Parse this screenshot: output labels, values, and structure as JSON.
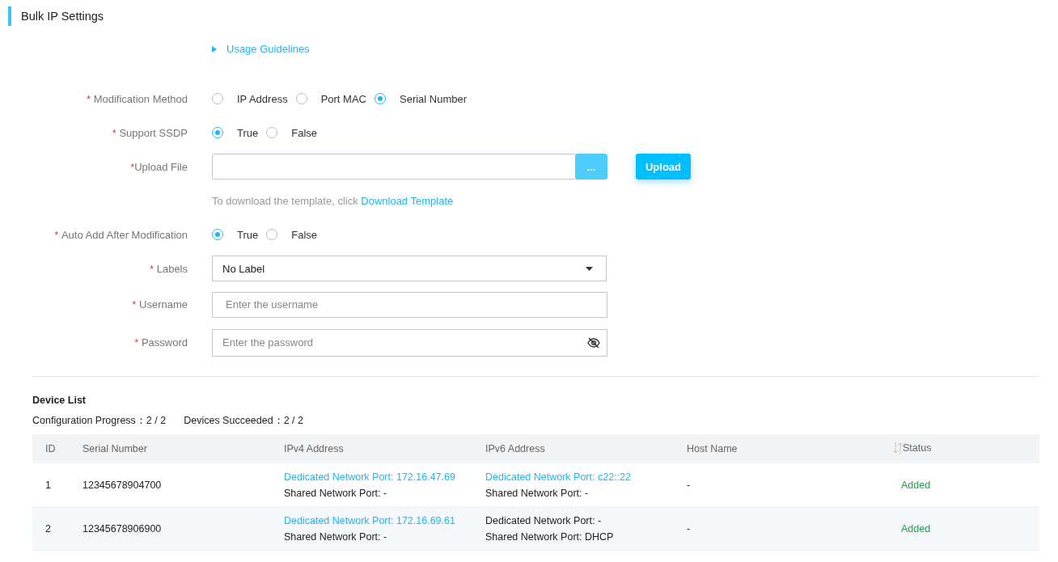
{
  "title": "Bulk IP Settings",
  "guidelines": {
    "label": "Usage Guidelines",
    "expanded": false
  },
  "form": {
    "method": {
      "mark": "*",
      "label": "Modification Method",
      "options": [
        {
          "label": "IP Address",
          "selected": false
        },
        {
          "label": "Port MAC",
          "selected": false
        },
        {
          "label": "Serial Number",
          "selected": true
        }
      ]
    },
    "ssdp": {
      "mark": "*",
      "label": "Support SSDP",
      "options": [
        {
          "label": "True",
          "selected": true
        },
        {
          "label": "False",
          "selected": false
        }
      ]
    },
    "upload": {
      "mark": "*",
      "label": "Upload File",
      "browse": "...",
      "button": "Upload"
    },
    "template_hint": {
      "text": "To download the template, click",
      "link": "Download Template"
    },
    "auto_add": {
      "mark": "*",
      "label": "Auto Add After Modification",
      "options": [
        {
          "label": "True",
          "selected": true
        },
        {
          "label": "False",
          "selected": false
        }
      ]
    },
    "labels": {
      "mark": "*",
      "label": "Labels",
      "value": "No Label"
    },
    "username": {
      "mark": "*",
      "label": "Username",
      "placeholder": "Enter the username"
    },
    "password": {
      "mark": "*",
      "label": "Password",
      "placeholder": "Enter the password"
    }
  },
  "device_list": {
    "title": "Device List",
    "stats": [
      {
        "label": "Configuration Progress：",
        "value": "2 / 2"
      },
      {
        "label": "Devices Succeeded：",
        "value": "2 / 2"
      }
    ],
    "columns": [
      "ID",
      "Serial Number",
      "IPv4 Address",
      "IPv6 Address",
      "Host Name",
      "Status"
    ],
    "rows": [
      {
        "id": "1",
        "serial": "12345678904700",
        "ipv4": [
          {
            "text": "Dedicated Network Port: 172.16.47.69",
            "link": true
          },
          {
            "text": "Shared Network Port: -",
            "link": false
          }
        ],
        "ipv6": [
          {
            "text": "Dedicated Network Port: c22::22",
            "link": true
          },
          {
            "text": "Shared Network Port: -",
            "link": false
          }
        ],
        "host": "-",
        "status": "Added"
      },
      {
        "id": "2",
        "serial": "12345678906900",
        "ipv4": [
          {
            "text": "Dedicated Network Port: 172.16.69.61",
            "link": true
          },
          {
            "text": "Shared Network Port: -",
            "link": false
          }
        ],
        "ipv6": [
          {
            "text": "Dedicated Network Port: -",
            "link": false
          },
          {
            "text": "Shared Network Port: DHCP",
            "link": false
          }
        ],
        "host": "-",
        "status": "Added"
      }
    ]
  }
}
